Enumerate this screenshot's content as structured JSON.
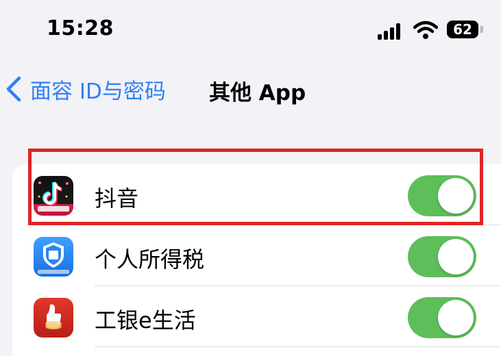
{
  "status_bar": {
    "time": "15:28",
    "battery": "62",
    "icons": [
      "cellular-signal-icon",
      "wifi-icon",
      "battery-icon"
    ]
  },
  "nav": {
    "back_label": "面容 ID与密码",
    "title": "其他 App"
  },
  "apps": [
    {
      "name": "抖音",
      "icon": "douyin-app-icon",
      "enabled": true
    },
    {
      "name": "个人所得税",
      "icon": "personal-income-tax-app-icon",
      "enabled": true
    },
    {
      "name": "工银e生活",
      "icon": "icbc-e-life-app-icon",
      "enabled": true
    }
  ],
  "colors": {
    "accent": "#2f7ff6",
    "toggle_on": "#5dbe5a",
    "highlight": "#e02424",
    "background": "#f2f2f7"
  }
}
